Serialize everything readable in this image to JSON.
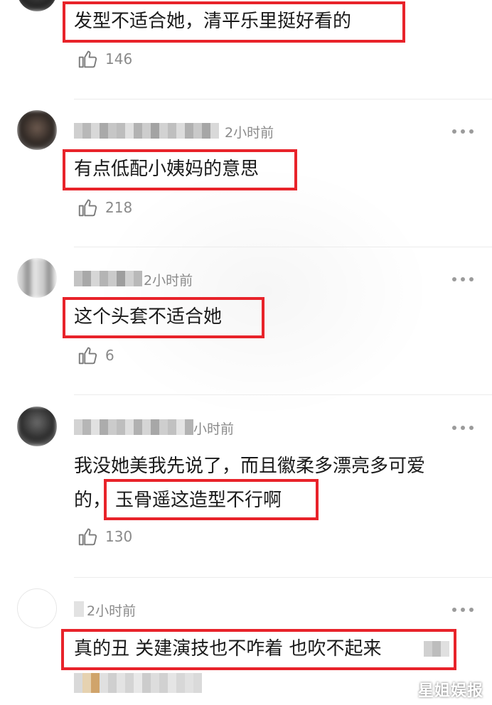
{
  "comments": [
    {
      "time": "",
      "text": "发型不适合她，清平乐里挺好看的",
      "text_line2": "",
      "likes": "146"
    },
    {
      "time": "2小时前",
      "text": "有点低配小姨妈的意思",
      "text_line2": "",
      "likes": "218"
    },
    {
      "time": "2小时前",
      "text": "这个头套不适合她",
      "text_line2": "",
      "likes": "6"
    },
    {
      "time": "小时前",
      "text": "我没她美我先说了，而且徽柔多漂亮多可爱",
      "text_line2_prefix": "的，",
      "text_line2": "玉骨遥这造型不行啊",
      "likes": "130"
    },
    {
      "time": "2小时前",
      "text": "真的丑 关建演技也不咋着 也吹不起来",
      "text_line2": "",
      "likes": ""
    }
  ],
  "icons": {
    "like": "thumbs-up-icon",
    "more": "more-dots-icon"
  },
  "colors": {
    "highlight": "#e8232a",
    "muted": "#8a8a8a",
    "text": "#1a1a1a"
  },
  "watermark": "星姐娱报"
}
